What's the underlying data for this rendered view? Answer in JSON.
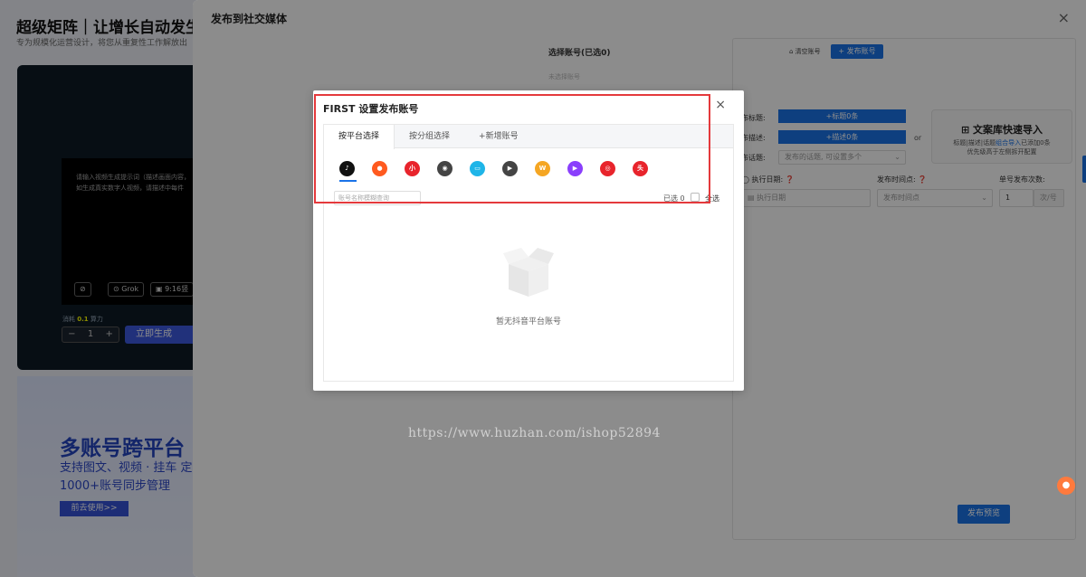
{
  "background": {
    "title": "超级矩阵｜让增长自动发生",
    "subtitle": "专为规模化运营设计，将您从重复性工作解放出",
    "prompt_text": "请输入视频生成提示词（描述画面内容，如生成真实数字人视频，请描述中每件",
    "chips": [
      "",
      "Grok",
      "9:16竖"
    ],
    "credits_label": "消耗",
    "credits_value": "0.1",
    "credits_unit": "算力",
    "stepper": {
      "minus": "−",
      "value": "1",
      "plus": "+"
    },
    "generate_button": "立即生成",
    "banner_big": "多账号跨平台",
    "banner_line1": "支持图文、视频 · 挂车 定",
    "banner_line2": "1000+账号同步管理",
    "banner_button": "前去使用>>"
  },
  "drawer": {
    "title": "发布到社交媒体",
    "close": "×",
    "select_account": "选择账号(已选0)",
    "clear_accounts": "清空账号",
    "publish_account_button": "+ 发布账号",
    "select_placeholder": "未选择账号",
    "title_label": "布标题:",
    "title_button": "+标题0条",
    "desc_label": "布描述:",
    "desc_button": "+描述0条",
    "or": "or",
    "topic_label": "布话题:",
    "topic_placeholder": "发布的话题, 可设置多个",
    "import_title": "文案库快速导入",
    "import_desc_1": "标题|描述|话题",
    "import_desc_link": "组合导入",
    "import_desc_2": "已添加0条",
    "import_desc_3": "优先级高于左侧拆开配置",
    "exec_date_label": "执行日期:",
    "exec_date_placeholder": "执行日期",
    "time_label": "发布时间点:",
    "time_placeholder": "发布时间点",
    "count_label": "单号发布次数:",
    "count_value": "1",
    "count_unit": "次/号",
    "preview_button": "发布预览"
  },
  "watermark": "https://www.huzhan.com/ishop52894",
  "dialog": {
    "title": "FIRST 设置发布账号",
    "close": "×",
    "tabs": [
      "按平台选择",
      "按分组选择",
      "+新增账号"
    ],
    "platforms": [
      {
        "icon": "douyin-icon",
        "glyph": "♪",
        "color": "#111111"
      },
      {
        "icon": "kuaishou-icon",
        "glyph": "●",
        "color": "#ff5a1f"
      },
      {
        "icon": "xiaohongshu-icon",
        "glyph": "小",
        "color": "#e8242c"
      },
      {
        "icon": "video-channel-icon",
        "glyph": "◉",
        "color": "#444444"
      },
      {
        "icon": "bilibili-icon",
        "glyph": "▭",
        "color": "#1fb5e8"
      },
      {
        "icon": "xigua-icon",
        "glyph": "▶",
        "color": "#444444"
      },
      {
        "icon": "weishi-icon",
        "glyph": "W",
        "color": "#f5a623"
      },
      {
        "icon": "haokan-icon",
        "glyph": "▶",
        "color": "#8a3ffc"
      },
      {
        "icon": "baidu-icon",
        "glyph": "◎",
        "color": "#e8242c"
      },
      {
        "icon": "toutiao-icon",
        "glyph": "头",
        "color": "#e8242c"
      }
    ],
    "search_placeholder": "账号名称模糊查询",
    "selected": "已选 0",
    "select_all": "全选",
    "empty": "暂无抖音平台账号"
  }
}
